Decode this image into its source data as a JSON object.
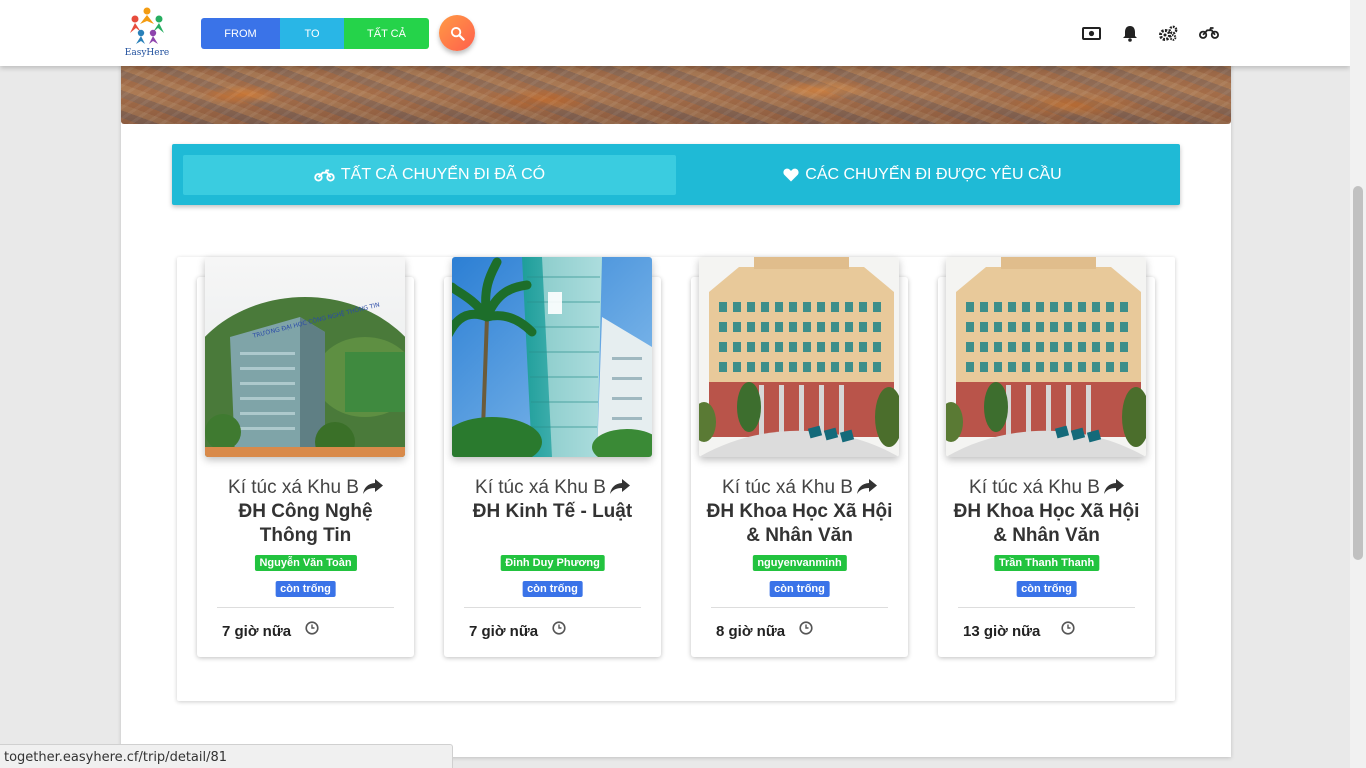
{
  "brand": {
    "name": "EasyHere"
  },
  "nav": {
    "from_label": "FROM",
    "to_label": "TO",
    "all_label": "TẤT CẢ",
    "icons": [
      "money-icon",
      "bell-icon",
      "cogs-icon",
      "motorcycle-icon"
    ]
  },
  "tabs": [
    {
      "label": "TẤT CẢ CHUYẾN ĐI ĐÃ CÓ",
      "icon": "motorcycle-icon",
      "active": true
    },
    {
      "label": "CÁC CHUYẾN ĐI ĐƯỢC YÊU CẦU",
      "icon": "heart-icon",
      "active": false
    }
  ],
  "trips": [
    {
      "from": "Kí túc xá Khu B",
      "to": "ĐH Công Nghệ Thông Tin",
      "driver": "Nguyễn Văn Toàn",
      "status": "còn trống",
      "time": "7 giờ nữa"
    },
    {
      "from": "Kí túc xá Khu B",
      "to": "ĐH Kinh Tế - Luật",
      "driver": "Đinh Duy Phương",
      "status": "còn trống",
      "time": "7 giờ nữa"
    },
    {
      "from": "Kí túc xá Khu B",
      "to": "ĐH Khoa Học Xã Hội & Nhân Văn",
      "driver": "nguyenvanminh",
      "status": "còn trống",
      "time": "8 giờ nữa"
    },
    {
      "from": "Kí túc xá Khu B",
      "to": "ĐH Khoa Học Xã Hội & Nhân Văn",
      "driver": "Trần Thanh Thanh",
      "status": "còn trống",
      "time": "13 giờ nữa"
    }
  ],
  "status_url": "together.easyhere.cf/trip/detail/81",
  "colors": {
    "accent": "#1fbad6",
    "from": "#3a73e8",
    "to": "#29b6e6",
    "all": "#25d34a",
    "badge_green": "#22c33f",
    "badge_blue": "#3a73e8"
  }
}
